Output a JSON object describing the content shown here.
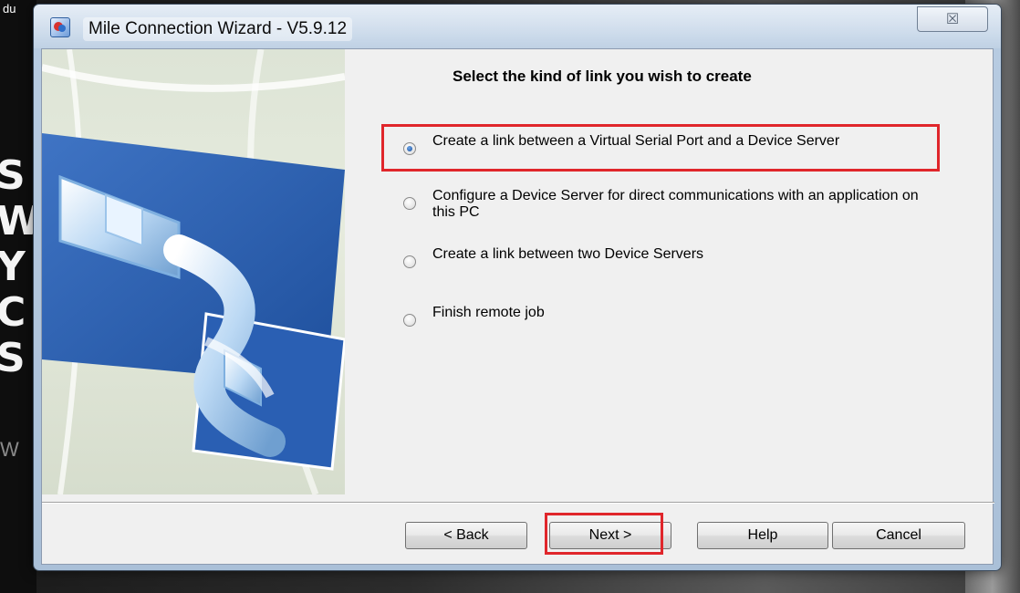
{
  "desktop": {
    "corner_text": "du",
    "side_letters": [
      "S",
      "W",
      "Y",
      "C",
      "S"
    ],
    "side_letter_small": "W"
  },
  "window": {
    "title": "Mile Connection Wizard - V5.9.12",
    "close_symbol": "☒",
    "app_icon": "wizard-app-icon"
  },
  "wizard": {
    "heading": "Select the kind of link you wish to create",
    "options": [
      {
        "label": "Create a link between a Virtual Serial Port and a Device Server",
        "selected": true
      },
      {
        "label": "Configure a Device Server for direct communications with an application on this PC",
        "selected": false
      },
      {
        "label": "Create a link between two Device Servers",
        "selected": false
      },
      {
        "label": "Finish remote job",
        "selected": false
      }
    ],
    "buttons": {
      "back": "< Back",
      "next": "Next >",
      "help": "Help",
      "cancel": "Cancel"
    },
    "highlight_color": "#e0262b"
  }
}
